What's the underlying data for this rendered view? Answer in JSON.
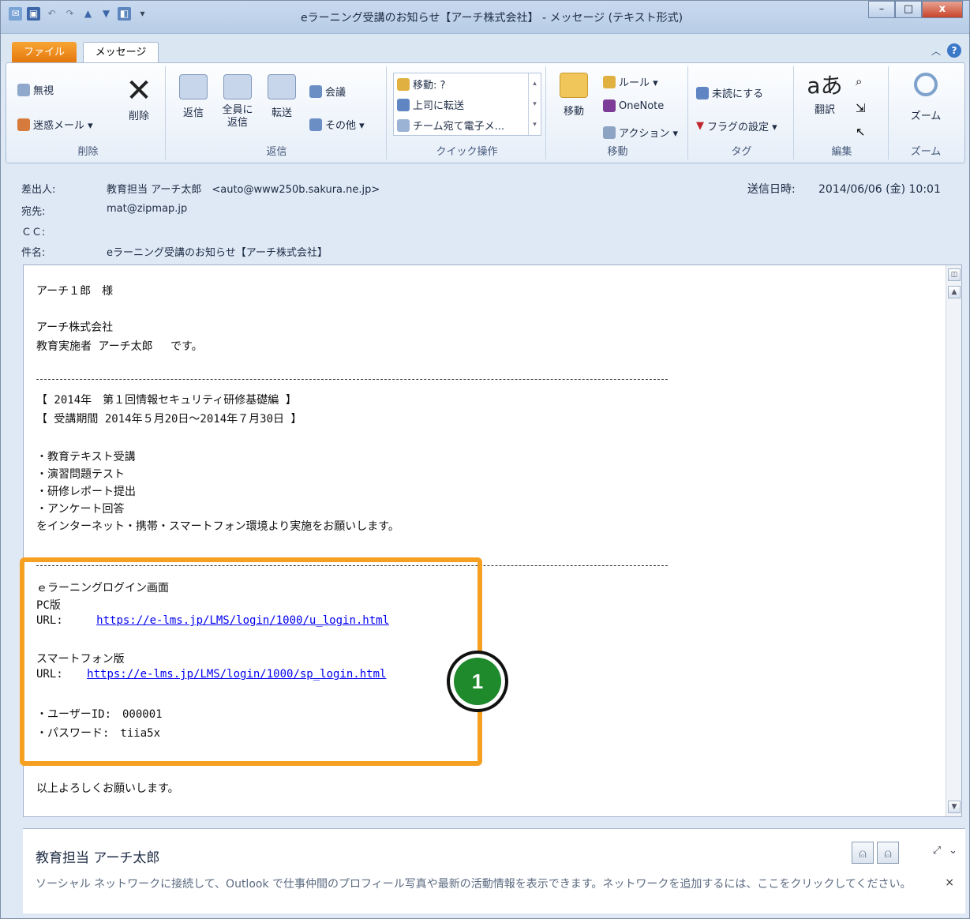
{
  "window": {
    "title": "eラーニング受講のお知らせ【アーチ株式会社】 - メッセージ (テキスト形式)",
    "minimize": "–",
    "maximize": "□",
    "close": "x"
  },
  "tabs": {
    "file": "ファイル",
    "message": "メッセージ"
  },
  "ribbon": {
    "delete_group": {
      "ignore": "無視",
      "junk": "迷惑メール ▾",
      "delete": "削除",
      "label": "削除"
    },
    "reply_group": {
      "reply": "返信",
      "reply_all": "全員に返信",
      "forward": "転送",
      "meeting": "会議",
      "more": "その他 ▾",
      "label": "返信"
    },
    "quick_steps": {
      "move": "移動: ?",
      "to_manager": "上司に転送",
      "team_email": "チーム宛て電子メ...",
      "label": "クイック操作"
    },
    "move_group": {
      "move": "移動",
      "rules": "ルール ▾",
      "onenote": "OneNote",
      "actions": "アクション ▾",
      "label": "移動"
    },
    "tags_group": {
      "unread": "未読にする",
      "flag": "フラグの設定 ▾",
      "label": "タグ"
    },
    "edit_group": {
      "translate": "翻訳",
      "label": "編集"
    },
    "zoom_group": {
      "zoom": "ズーム",
      "label": "ズーム"
    }
  },
  "header": {
    "from_label": "差出人:",
    "from_value": "教育担当 アーチ太郎　<auto@www250b.sakura.ne.jp>",
    "to_label": "宛先:",
    "to_value": "mat@zipmap.jp",
    "cc_label": "ＣＣ:",
    "subject_label": "件名:",
    "subject_value": "eラーニング受講のお知らせ【アーチ株式会社】",
    "sent_label": "送信日時:",
    "sent_value": "2014/06/06 (金) 10:01"
  },
  "body": {
    "greeting": "アーチ１郎　様",
    "company": "アーチ株式会社",
    "sender": "教育実施者 アーチ太郎　 です。",
    "course_title": "【 2014年　第１回情報セキュリティ研修基礎編 】",
    "course_period": "【 受講期間 2014年５月20日～2014年７月30日 】",
    "items": [
      "・教育テキスト受講",
      "・演習問題テスト",
      "・研修レポート提出",
      "・アンケート回答"
    ],
    "request": "をインターネット・携帯・スマートフォン環境より実施をお願いします。",
    "login_title": "ｅラーニングログイン画面",
    "pc_label": "PC版",
    "url_label": "URL:",
    "pc_url": "https://e-lms.jp/LMS/login/1000/u_login.html",
    "sp_label": "スマートフォン版",
    "sp_url": "https://e-lms.jp/LMS/login/1000/sp_login.html",
    "user_id": "・ユーザーID:　000001",
    "password": "・パスワード:　tiia5x",
    "closing": "以上よろしくお願いします。",
    "badge": "1"
  },
  "people_pane": {
    "name": "教育担当 アーチ太郎",
    "info": "ソーシャル ネットワークに接続して、Outlook で仕事仲間のプロフィール写真や最新の活動情報を表示できます。ネットワークを追加するには、ここをクリックしてください。",
    "close": "×"
  },
  "colors": {
    "highlight": "#f5a020",
    "badge": "#1e8a2c",
    "file_tab": "#e5760c",
    "link": "#0000ee"
  }
}
